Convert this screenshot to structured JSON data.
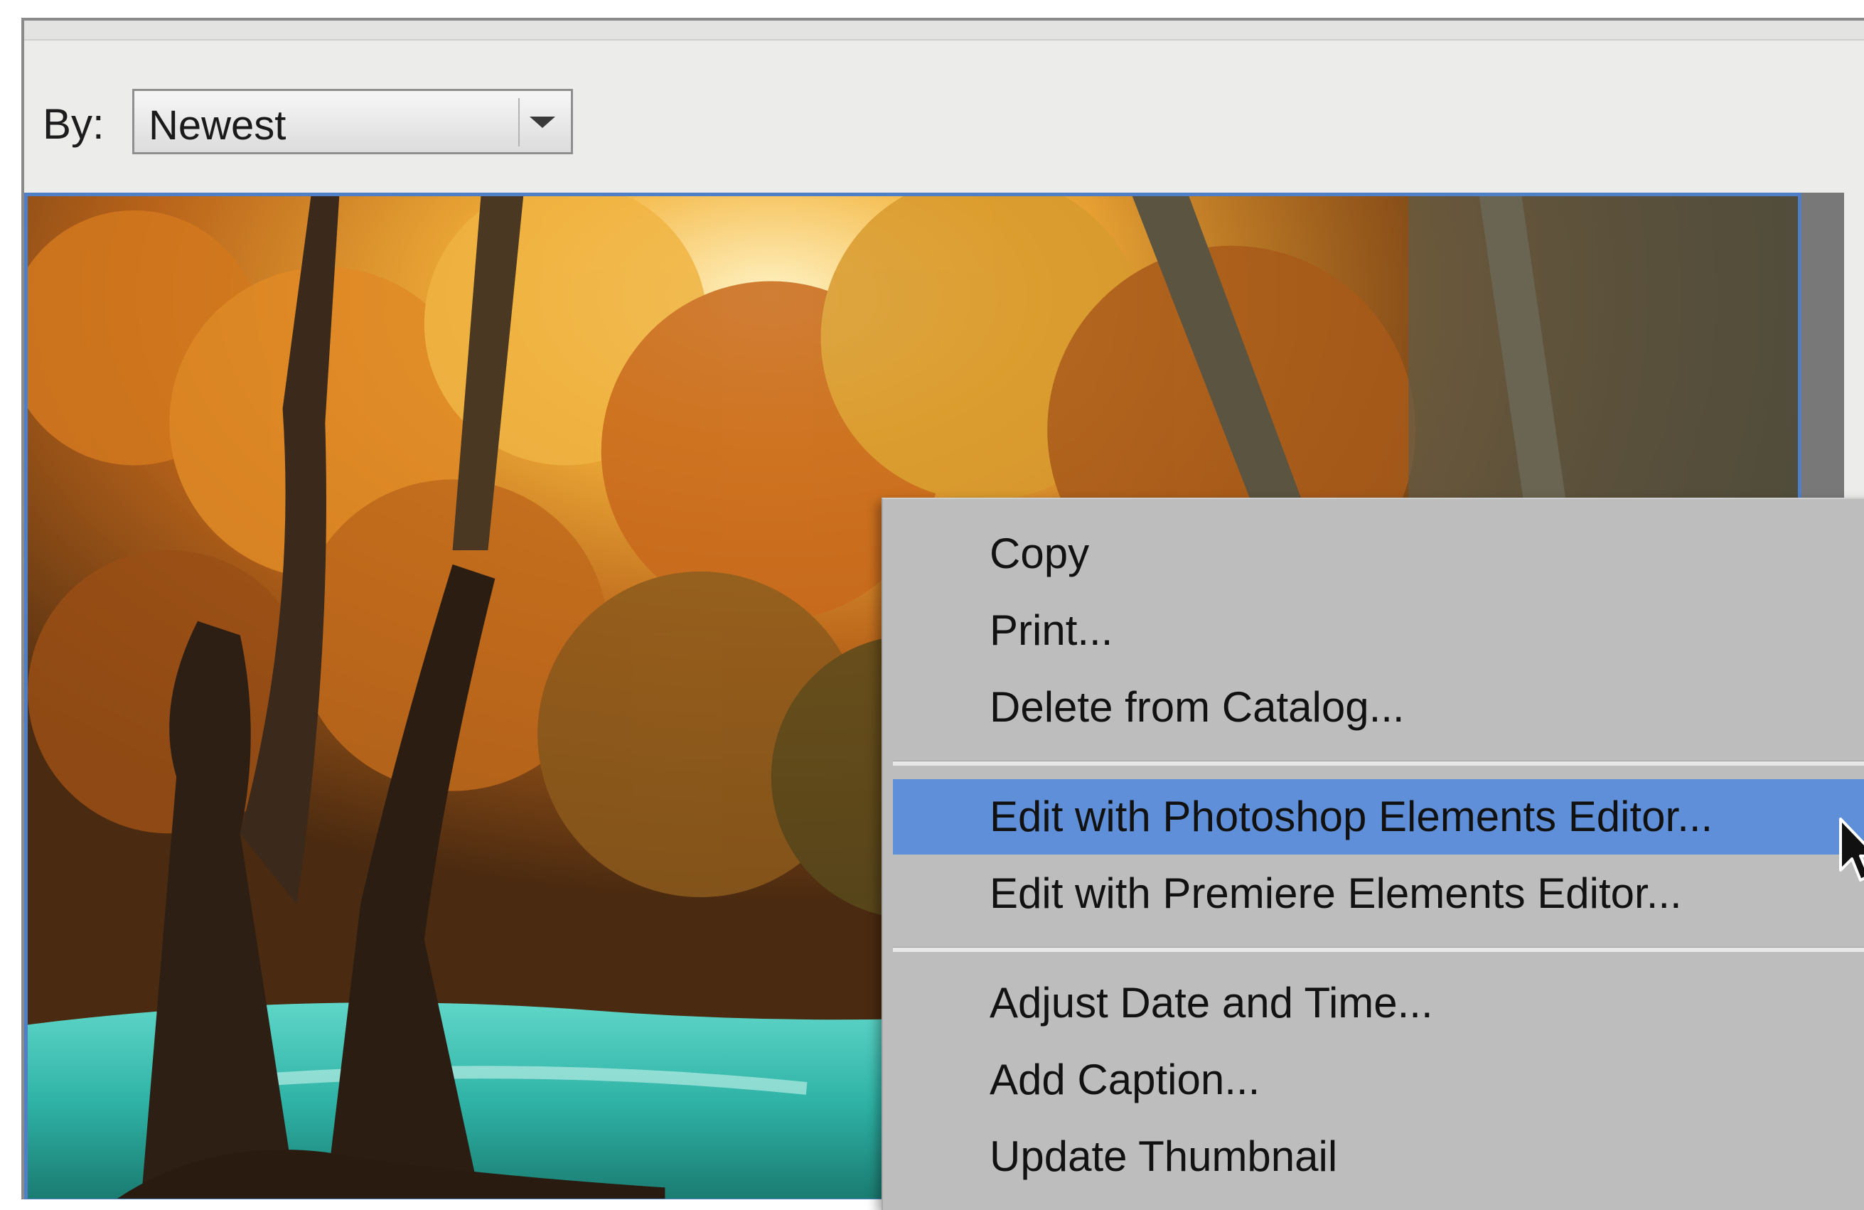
{
  "sort": {
    "label": "By:",
    "selected": "Newest"
  },
  "context_menu": {
    "items": [
      {
        "label": "Copy"
      },
      {
        "label": "Print..."
      },
      {
        "label": "Delete from Catalog..."
      },
      {
        "label": "Edit with Photoshop Elements Editor..."
      },
      {
        "label": "Edit with Premiere Elements Editor..."
      },
      {
        "label": "Adjust Date and Time..."
      },
      {
        "label": "Add Caption..."
      },
      {
        "label": "Update Thumbnail"
      }
    ],
    "highlighted_index": 3
  },
  "colors": {
    "highlight": "#5e8fd8",
    "selection_border": "#4f7fc7"
  },
  "icons": {
    "dropdown": "chevron-down-icon",
    "cursor": "mouse-pointer-icon"
  }
}
